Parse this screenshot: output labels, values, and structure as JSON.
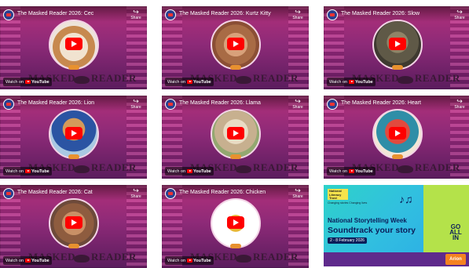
{
  "videos": [
    {
      "title": "The Masked Reader 2026: Cec",
      "portrait": "dog-mask",
      "share": "Share",
      "watch_on": "Watch on",
      "youtube": "YouTube",
      "brand_left": "MASKED",
      "brand_right": "READER"
    },
    {
      "title": "The Masked Reader 2026: Kurtz Kitty",
      "portrait": "cat-mask",
      "share": "Share",
      "watch_on": "Watch on",
      "youtube": "YouTube",
      "brand_left": "MASKED",
      "brand_right": "READER"
    },
    {
      "title": "The Masked Reader 2026: Slow",
      "portrait": "turtle-mask",
      "share": "Share",
      "watch_on": "Watch on",
      "youtube": "YouTube",
      "brand_left": "MASKED",
      "brand_right": "READER"
    },
    {
      "title": "The Masked Reader 2026: Lion",
      "portrait": "lion-mask",
      "share": "Share",
      "watch_on": "Watch on",
      "youtube": "YouTube",
      "brand_left": "MASKED",
      "brand_right": "READER"
    },
    {
      "title": "The Masked Reader 2026: Llama",
      "portrait": "alpaca-mask",
      "share": "Share",
      "watch_on": "Watch on",
      "youtube": "YouTube",
      "brand_left": "MASKED",
      "brand_right": "READER"
    },
    {
      "title": "The Masked Reader 2026: Heart",
      "portrait": "monster-mask",
      "share": "Share",
      "watch_on": "Watch on",
      "youtube": "YouTube",
      "brand_left": "MASKED",
      "brand_right": "READER"
    },
    {
      "title": "The Masked Reader 2026: Cat",
      "portrait": "person-mask",
      "share": "Share",
      "watch_on": "Watch on",
      "youtube": "YouTube",
      "brand_left": "MASKED",
      "brand_right": "READER"
    },
    {
      "title": "The Masked Reader 2026: Chicken",
      "portrait": "chicken-mask",
      "share": "Share",
      "watch_on": "Watch on",
      "youtube": "YouTube",
      "brand_left": "MASKED",
      "brand_right": "READER"
    }
  ],
  "promo": {
    "logo": "National Literacy Trust",
    "small": "Changing stories Changing lives",
    "headline1": "National Storytelling Week",
    "headline2": "Soundtrack your story",
    "date": "2 - 8 February 2026",
    "go": "GO ALL IN",
    "sponsor": "Arion"
  },
  "colors": {
    "tile_top": "#b2307a",
    "tile_bottom": "#5a1c5d",
    "play_red": "#ff0000",
    "promo_blue": "#2aa6e8",
    "promo_lime": "#b4e24a",
    "promo_navy": "#0b1e5a"
  }
}
